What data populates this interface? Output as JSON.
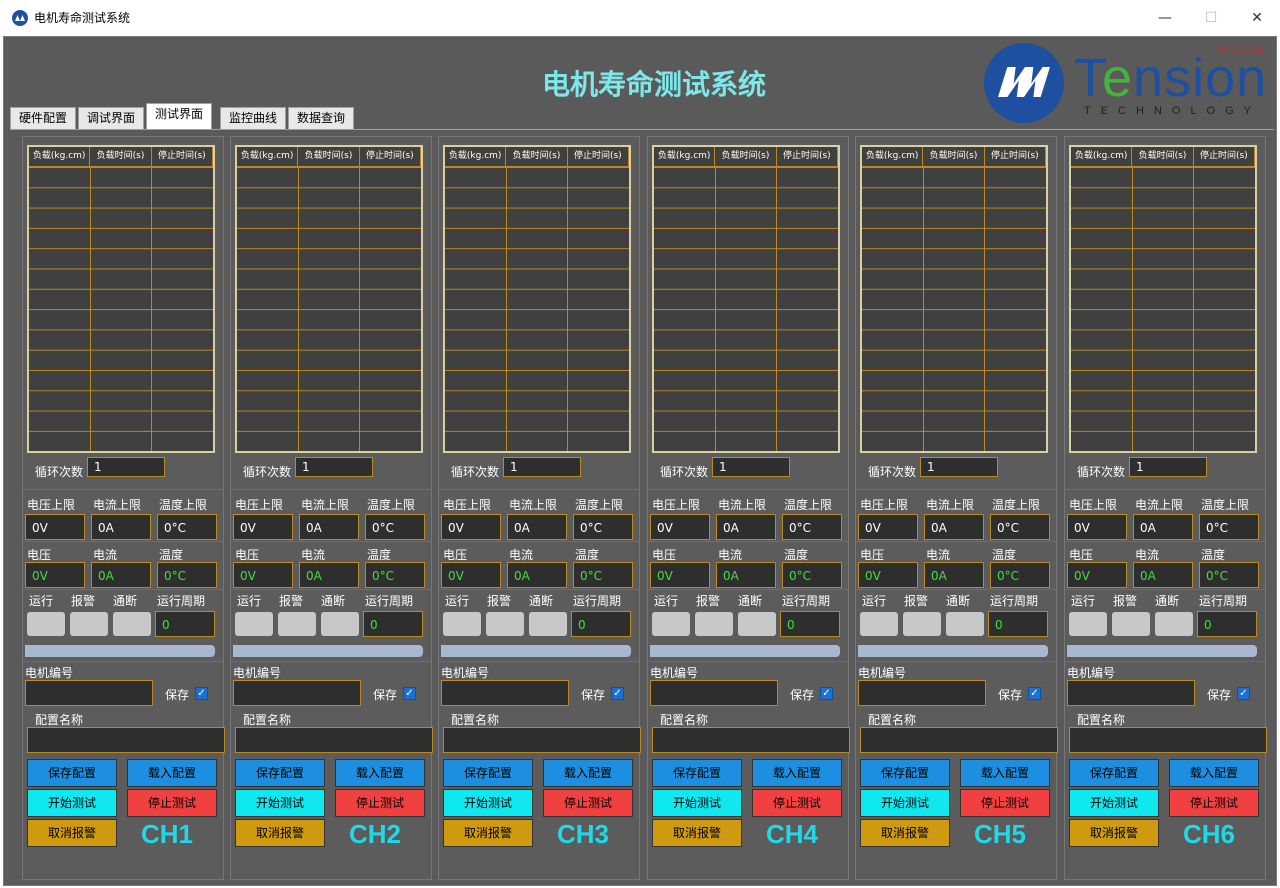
{
  "window": {
    "title": "电机寿命测试系统",
    "minimize_icon": "minimize-icon",
    "maximize_icon": "maximize-icon",
    "close_icon": "close-icon"
  },
  "header": {
    "title": "电机寿命测试系统",
    "logo_text": "Tension",
    "logo_sub": "TECHNOLOGY",
    "logo_date": "20220224"
  },
  "tabs": [
    {
      "label": "硬件配置"
    },
    {
      "label": "调试界面"
    },
    {
      "label": "测试界面",
      "active": true
    },
    {
      "label": "监控曲线"
    },
    {
      "label": "数据查询"
    }
  ],
  "colors": {
    "title": "#7ee8e8",
    "brand_blue": "#1e4fa0",
    "brand_green": "#46b43c",
    "date_red": "#e02020",
    "channel_label": "#20d8e8"
  },
  "labels": {
    "grid_col1": "负载(kg.cm)",
    "grid_col2": "负载时间(s)",
    "grid_col3": "停止时间(s)",
    "cycle": "循环次数",
    "v_limit": "电压上限",
    "i_limit": "电流上限",
    "t_limit": "温度上限",
    "voltage": "电压",
    "current": "电流",
    "temperature": "温度",
    "run": "运行",
    "alarm": "报警",
    "comm": "通断",
    "period": "运行周期",
    "motor_id": "电机编号",
    "save": "保存",
    "config_name": "配置名称",
    "save_config": "保存配置",
    "load_config": "载入配置",
    "start_test": "开始测试",
    "stop_test": "停止测试",
    "cancel_alarm": "取消报警"
  },
  "channels": [
    {
      "name": "CH1",
      "cycle": "1",
      "v_limit": "0V",
      "i_limit": "0A",
      "t_limit": "0°C",
      "voltage": "0V",
      "current": "0A",
      "temperature": "0°C",
      "period": "0",
      "motor_id": "",
      "config_name": "",
      "save_checked": true
    },
    {
      "name": "CH2",
      "cycle": "1",
      "v_limit": "0V",
      "i_limit": "0A",
      "t_limit": "0°C",
      "voltage": "0V",
      "current": "0A",
      "temperature": "0°C",
      "period": "0",
      "motor_id": "",
      "config_name": "",
      "save_checked": true
    },
    {
      "name": "CH3",
      "cycle": "1",
      "v_limit": "0V",
      "i_limit": "0A",
      "t_limit": "0°C",
      "voltage": "0V",
      "current": "0A",
      "temperature": "0°C",
      "period": "0",
      "motor_id": "",
      "config_name": "",
      "save_checked": true
    },
    {
      "name": "CH4",
      "cycle": "1",
      "v_limit": "0V",
      "i_limit": "0A",
      "t_limit": "0°C",
      "voltage": "0V",
      "current": "0A",
      "temperature": "0°C",
      "period": "0",
      "motor_id": "",
      "config_name": "",
      "save_checked": true
    },
    {
      "name": "CH5",
      "cycle": "1",
      "v_limit": "0V",
      "i_limit": "0A",
      "t_limit": "0°C",
      "voltage": "0V",
      "current": "0A",
      "temperature": "0°C",
      "period": "0",
      "motor_id": "",
      "config_name": "",
      "save_checked": true
    },
    {
      "name": "CH6",
      "cycle": "1",
      "v_limit": "0V",
      "i_limit": "0A",
      "t_limit": "0°C",
      "voltage": "0V",
      "current": "0A",
      "temperature": "0°C",
      "period": "0",
      "motor_id": "",
      "config_name": "",
      "save_checked": true
    }
  ]
}
